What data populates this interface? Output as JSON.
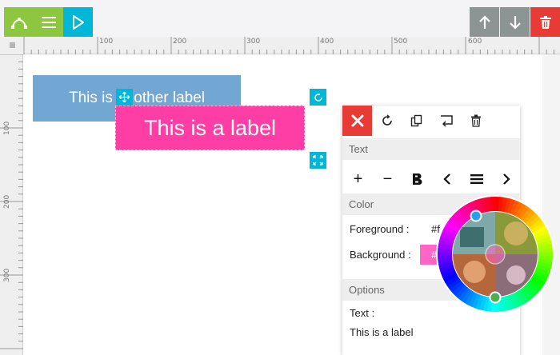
{
  "toolbar": {
    "left_buttons": [
      {
        "icon": "bezier-curve-icon",
        "color": "#8dc63f"
      },
      {
        "icon": "menu-icon",
        "color": "#8dc63f"
      },
      {
        "icon": "play-icon",
        "color": "#00b7d8"
      }
    ],
    "right_buttons": [
      {
        "icon": "arrow-up-icon",
        "color": "#8d9494"
      },
      {
        "icon": "arrow-down-icon",
        "color": "#8d9494"
      },
      {
        "icon": "trash-icon",
        "color": "#e83b35"
      }
    ]
  },
  "rulers": {
    "top_labels": [
      "100",
      "200",
      "300",
      "400",
      "500",
      "600"
    ],
    "left_labels": [
      "100",
      "200",
      "300"
    ]
  },
  "canvas": {
    "label_another": {
      "text": "This is another label",
      "color": "#73a7d3"
    },
    "label_main": {
      "text": "This is a label",
      "color": "#ff3ea5"
    }
  },
  "panel": {
    "tools": [
      "close-icon",
      "rotate-icon",
      "duplicate-icon",
      "undo-icon",
      "trash-icon"
    ],
    "text_section": "Text",
    "format_buttons": [
      "+",
      "−",
      "bold-icon",
      "chevron-left-icon",
      "align-icon",
      "chevron-right-icon"
    ],
    "color_section": "Color",
    "foreground_label": "Foreground :",
    "foreground_value": "#f",
    "background_label": "Background :",
    "background_value": "#",
    "background_color": "#ff66c4",
    "options_section": "Options",
    "text_label": "Text :",
    "text_value": "This is a label"
  },
  "colors": {
    "accent_cyan": "#00b7d8",
    "accent_green": "#8dc63f",
    "danger_red": "#e83b35",
    "label_pink": "#ff3ea5",
    "label_blue": "#73a7d3"
  }
}
